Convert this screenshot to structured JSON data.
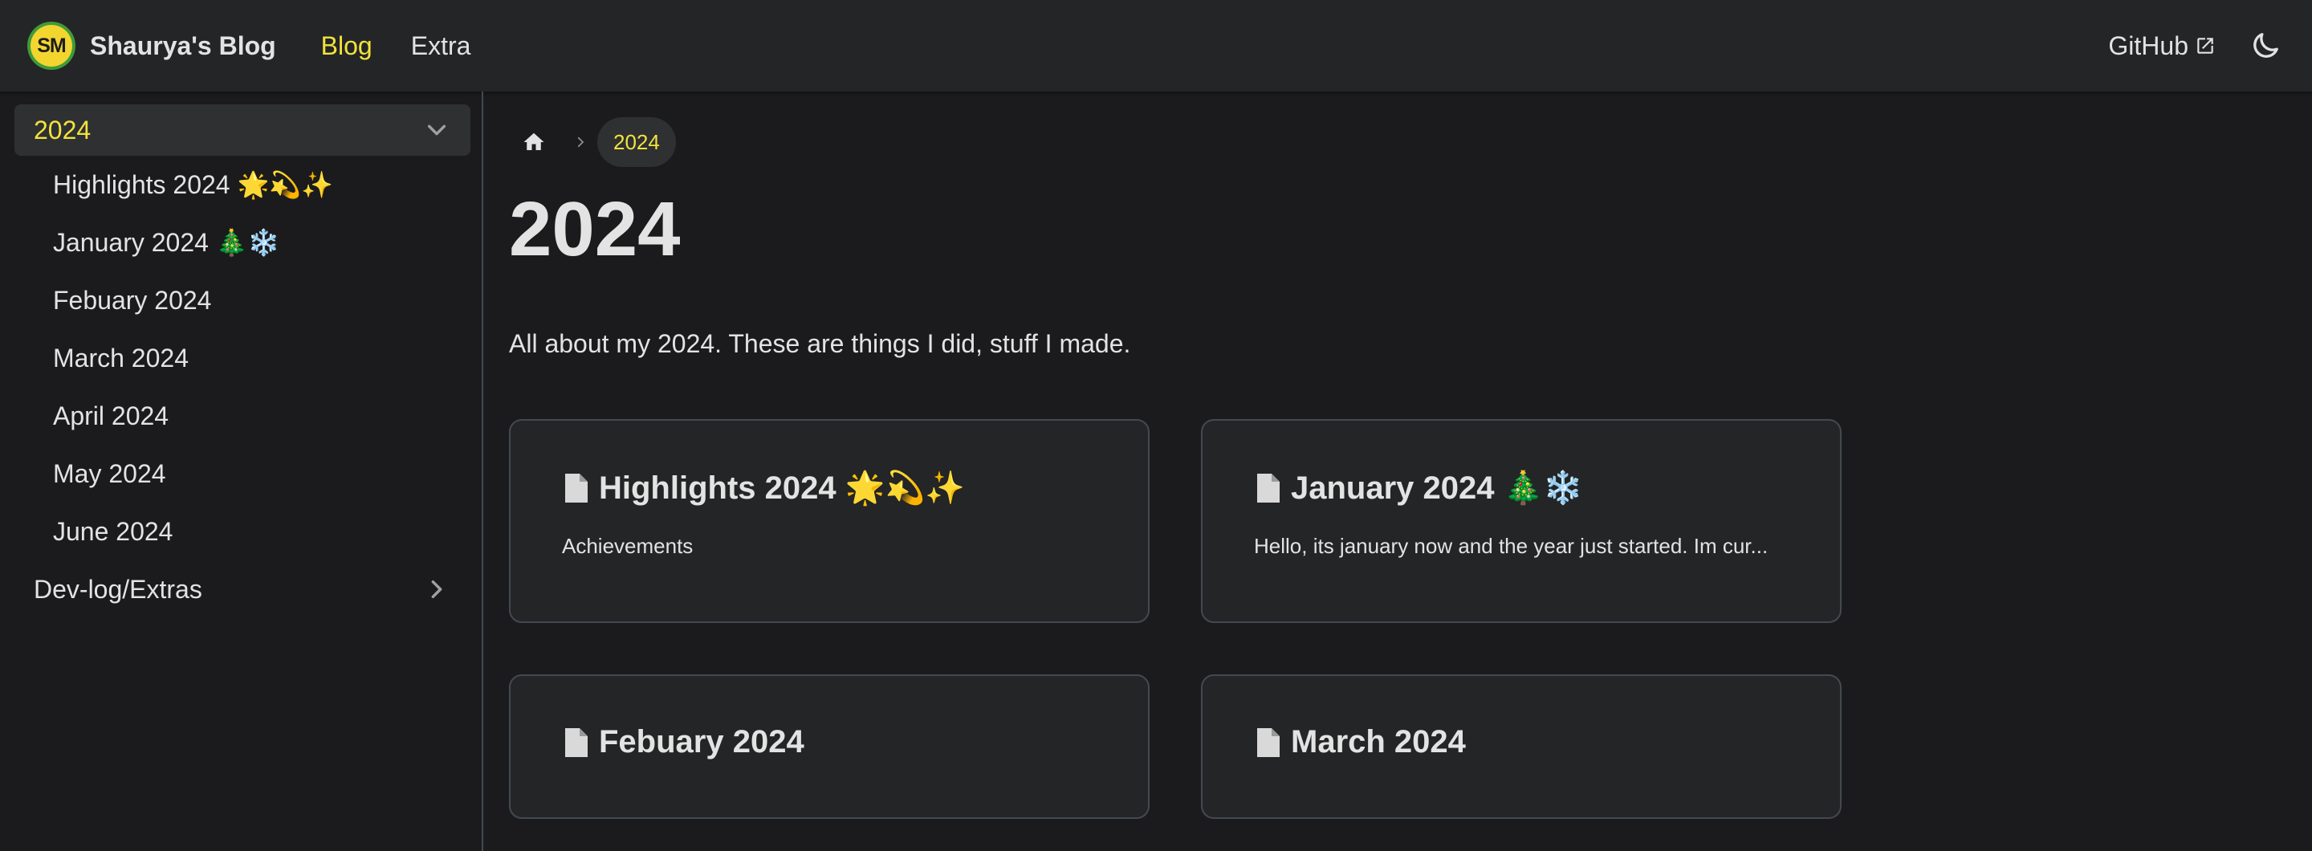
{
  "navbar": {
    "logo_text": "SM",
    "brand_title": "Shaurya's Blog",
    "links": [
      {
        "label": "Blog",
        "active": true
      },
      {
        "label": "Extra",
        "active": false
      }
    ],
    "github_label": "GitHub",
    "accent_color": "#f1e33c"
  },
  "sidebar": {
    "open_category": "2024",
    "items": [
      {
        "label": "Highlights 2024 🌟💫✨"
      },
      {
        "label": "January 2024 🎄❄️"
      },
      {
        "label": "Febuary 2024"
      },
      {
        "label": "March 2024"
      },
      {
        "label": "April 2024"
      },
      {
        "label": "May 2024"
      },
      {
        "label": "June 2024"
      }
    ],
    "closed_category": "Dev-log/Extras"
  },
  "breadcrumb": {
    "home_icon": "home-icon",
    "current": "2024"
  },
  "page": {
    "title": "2024",
    "description": "All about my 2024. These are things I did, stuff I made."
  },
  "cards": [
    {
      "title": "Highlights 2024 🌟💫✨",
      "description": "Achievements"
    },
    {
      "title": "January 2024 🎄❄️",
      "description": "Hello, its january now and the year just started. Im cur..."
    },
    {
      "title": "Febuary 2024",
      "description": ""
    },
    {
      "title": "March 2024",
      "description": ""
    }
  ]
}
